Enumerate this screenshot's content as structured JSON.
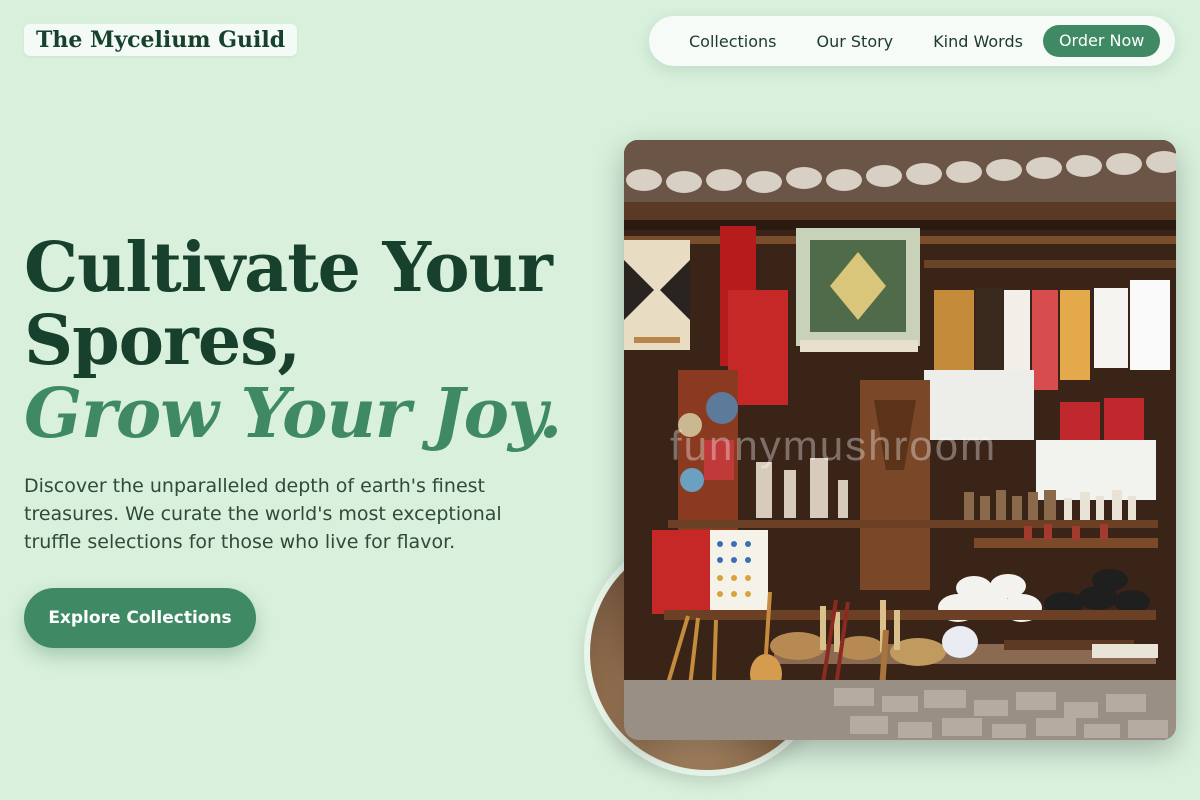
{
  "brand": {
    "name": "The Mycelium Guild"
  },
  "nav": {
    "links": [
      "Collections",
      "Our Story",
      "Kind Words"
    ],
    "order_label": "Order Now"
  },
  "hero": {
    "line1": "Cultivate Your",
    "line2": "Spores,",
    "line3": "Grow Your Joy.",
    "description": "Discover the unparalleled depth of earth's finest treasures. We curate the world's most exceptional truffle selections for those who live for flavor.",
    "cta_label": "Explore Collections",
    "image_watermark": "funnymushroom"
  },
  "colors": {
    "background": "#d8f0dc",
    "accent": "#3f8a64",
    "heading": "#17402d"
  }
}
